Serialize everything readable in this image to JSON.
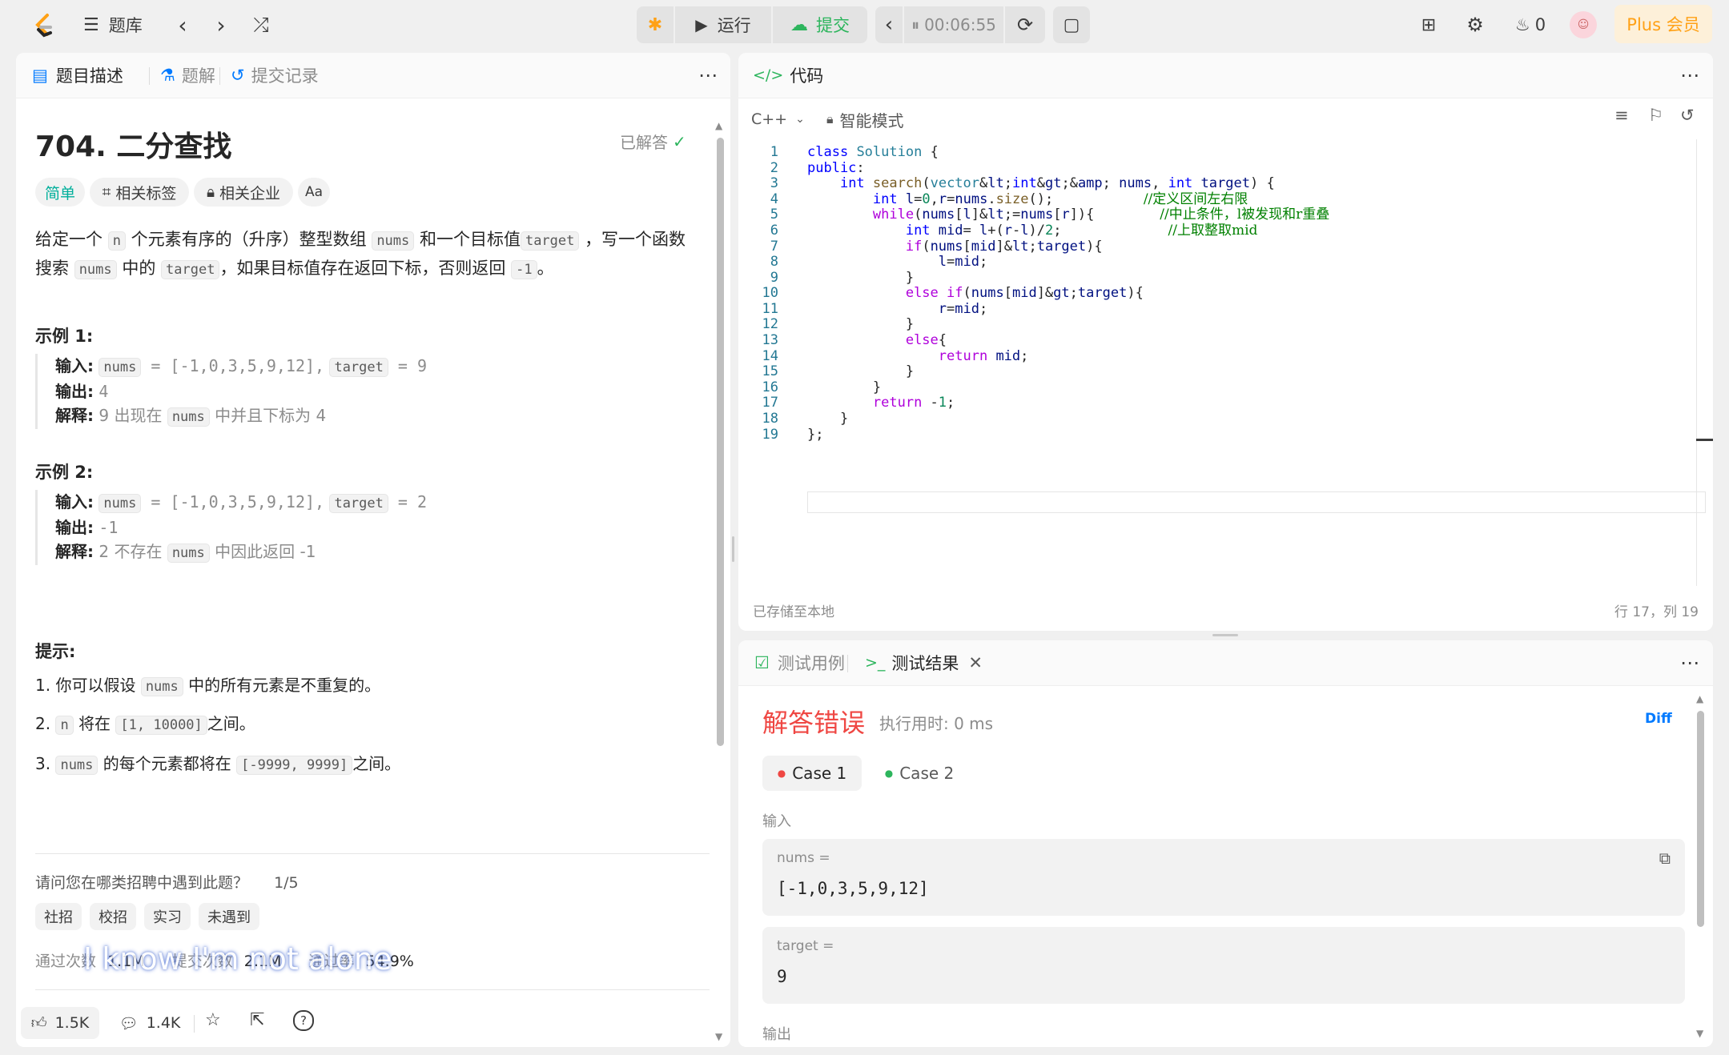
{
  "topbar": {
    "problem_list_label": "题库",
    "run_label": "运行",
    "submit_label": "提交",
    "timer": "00:06:55",
    "streak_count": "0",
    "plus_label": "Plus 会员",
    "colors": {
      "submit": "#2db55d",
      "plus": "#ffa116"
    }
  },
  "left": {
    "tabs": [
      "题目描述",
      "题解",
      "提交记录"
    ],
    "title": "704. 二分查找",
    "solved_label": "已解答",
    "tags": {
      "difficulty": "简单",
      "related_tags": "相关标签",
      "companies": "相关企业",
      "font_icon": "Aa"
    },
    "desc": {
      "p1_a": "给定一个",
      "p1_code_n": "n",
      "p1_b": "个元素有序的（升序）整型数组",
      "p1_code_nums": "nums",
      "p1_c": "和一个目标值",
      "p1_code_target": "target",
      "p1_d": "，写一个函数",
      "p2_a": "搜索",
      "p2_code_nums": "nums",
      "p2_b": "中的",
      "p2_code_target": "target",
      "p2_c": "，如果目标值存在返回下标，否则返回",
      "p2_code_neg": "-1",
      "p2_d": "。"
    },
    "example1": {
      "title": "示例 1:",
      "input_label": "输入:",
      "input_nums": "nums",
      "input_rest": " = [-1,0,3,5,9,12],",
      "input_target": "target",
      "input_val": " = 9",
      "output_label": "输出:",
      "output_val": "4",
      "explain_label": "解释:",
      "explain_a": "9 出现在",
      "explain_code": "nums",
      "explain_b": "中并且下标为 4"
    },
    "example2": {
      "title": "示例 2:",
      "input_label": "输入:",
      "input_nums": "nums",
      "input_rest": " = [-1,0,3,5,9,12],",
      "input_target": "target",
      "input_val": " = 2",
      "output_label": "输出:",
      "output_val": "-1",
      "explain_label": "解释:",
      "explain_a": "2 不存在",
      "explain_code": "nums",
      "explain_b": "中因此返回 -1"
    },
    "hints": {
      "title": "提示:",
      "h1_a": "1. 你可以假设",
      "h1_code": "nums",
      "h1_b": "中的所有元素是不重复的。",
      "h2_a": "2.",
      "h2_code1": "n",
      "h2_b": "将在",
      "h2_code2": "[1, 10000]",
      "h2_c": "之间。",
      "h3_a": "3.",
      "h3_code1": "nums",
      "h3_b": "的每个元素都将在",
      "h3_code2": "[-9999, 9999]",
      "h3_c": "之间。"
    },
    "survey": {
      "question": "请问您在哪类招聘中遇到此题？",
      "progress": "1/5",
      "options": [
        "社招",
        "校招",
        "实习",
        "未遇到"
      ]
    },
    "stats": {
      "accepted_label": "通过次数",
      "accepted_val": "1.1M",
      "submitted_label": "提交次数",
      "submitted_val": "2.1M",
      "rate_label": "通过率",
      "rate_val": "54.9%"
    },
    "overlay_text": "I know I'm not alone",
    "bottom": {
      "likes": "1.5K",
      "comments": "1.4K"
    }
  },
  "code": {
    "tab_label": "代码",
    "language": "C++",
    "mode_label": "智能模式",
    "lines": [
      "class Solution {",
      "public:",
      "    int search(vector<int>& nums, int target) {",
      "        int l=0,r=nums.size();           //定义区间左右限",
      "        while(nums[l]<=nums[r]){        //中止条件，l被发现和r重叠",
      "            int mid= l+(r-l)/2;             //上取整取mid",
      "            if(nums[mid]<target){",
      "                l=mid;",
      "            }",
      "            else if(nums[mid]>target){",
      "                r=mid;",
      "            }",
      "            else{",
      "                return mid;",
      "            }",
      "        }",
      "        return -1;",
      "    }",
      "};"
    ],
    "saved_label": "已存储至本地",
    "cursor_pos": "行 17，列 19"
  },
  "result": {
    "tabs": [
      "测试用例",
      "测试结果"
    ],
    "status": "解答错误",
    "runtime": "执行用时: 0 ms",
    "diff_label": "Diff",
    "cases": [
      "Case 1",
      "Case 2"
    ],
    "input_label": "输入",
    "nums_label": "nums =",
    "nums_val": "[-1,0,3,5,9,12]",
    "target_label": "target =",
    "target_val": "9",
    "output_label": "输出",
    "colors": {
      "error": "#ef4743",
      "case_dot_fail": "#ef4743",
      "case_dot_pass": "#2db55d"
    }
  }
}
